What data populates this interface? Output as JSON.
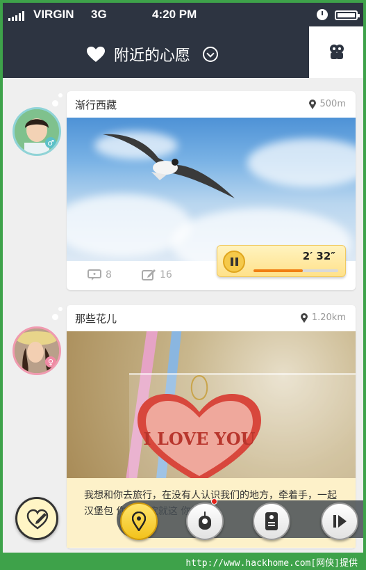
{
  "status_bar": {
    "carrier": "VIRGIN",
    "network": "3G",
    "time": "4:20 PM"
  },
  "header": {
    "title": "附近的心愿",
    "right_icon": "friends-icon"
  },
  "feed": [
    {
      "title": "渐行西藏",
      "distance": "500m",
      "avatar_gender": "male",
      "comments": "8",
      "shares": "16",
      "audio": {
        "duration": "2′ 32″",
        "progress": 0.58
      }
    },
    {
      "title": "那些花儿",
      "distance": "1.20km",
      "avatar_gender": "female",
      "caption": "我想和你去旅行，在没有人认识我们的地方，牵着手，一起 汉堡包 你可乐 欢就这 你相依",
      "photo_text": "I LOVE YOU"
    }
  ],
  "bottom_bar": {
    "fab_icon": "heart-edit-icon",
    "buttons": [
      "location-icon",
      "robot-icon",
      "document-icon",
      "play-icon"
    ]
  },
  "footer": {
    "text": "http://www.hackhome.com[网侠]提供"
  },
  "colors": {
    "header_bg": "#2d3441",
    "accent_yellow": "#f5c94a",
    "progress_orange": "#f07e12",
    "footer_green": "#3ea24a"
  }
}
